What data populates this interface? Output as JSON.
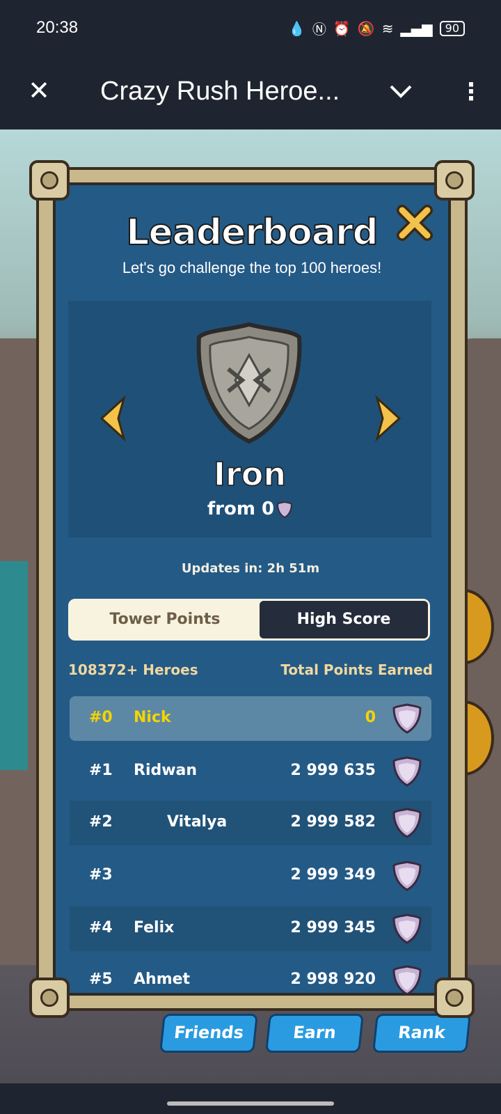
{
  "status_bar": {
    "time": "20:38",
    "battery": "90"
  },
  "app_bar": {
    "title": "Crazy Rush Heroe..."
  },
  "game": {
    "bottom_buttons": [
      "Friends",
      "Earn",
      "Rank"
    ]
  },
  "leaderboard": {
    "title": "Leaderboard",
    "subtitle": "Let's go challenge the top 100 heroes!",
    "rank": {
      "name": "Iron",
      "from_text": "from 0"
    },
    "updates": "Updates in: 2h 51m",
    "tabs": [
      "Tower Points",
      "High Score"
    ],
    "active_tab": "High Score",
    "heroes_count": "108372+ Heroes",
    "total_label": "Total Points Earned",
    "rows": [
      {
        "rank": "#0",
        "name": "Nick",
        "points": "0"
      },
      {
        "rank": "#1",
        "name": "Ridwan",
        "points": "2 999 635"
      },
      {
        "rank": "#2",
        "name": "Vitalya",
        "points": "2 999 582"
      },
      {
        "rank": "#3",
        "name": "",
        "points": "2 999 349"
      },
      {
        "rank": "#4",
        "name": "Felix",
        "points": "2 999 345"
      },
      {
        "rank": "#5",
        "name": "Ahmet",
        "points": "2 998 920"
      }
    ]
  },
  "colors": {
    "panel_blue": "#245a86",
    "highlight_yellow": "#f5d400",
    "header_dark": "#1f2530"
  }
}
